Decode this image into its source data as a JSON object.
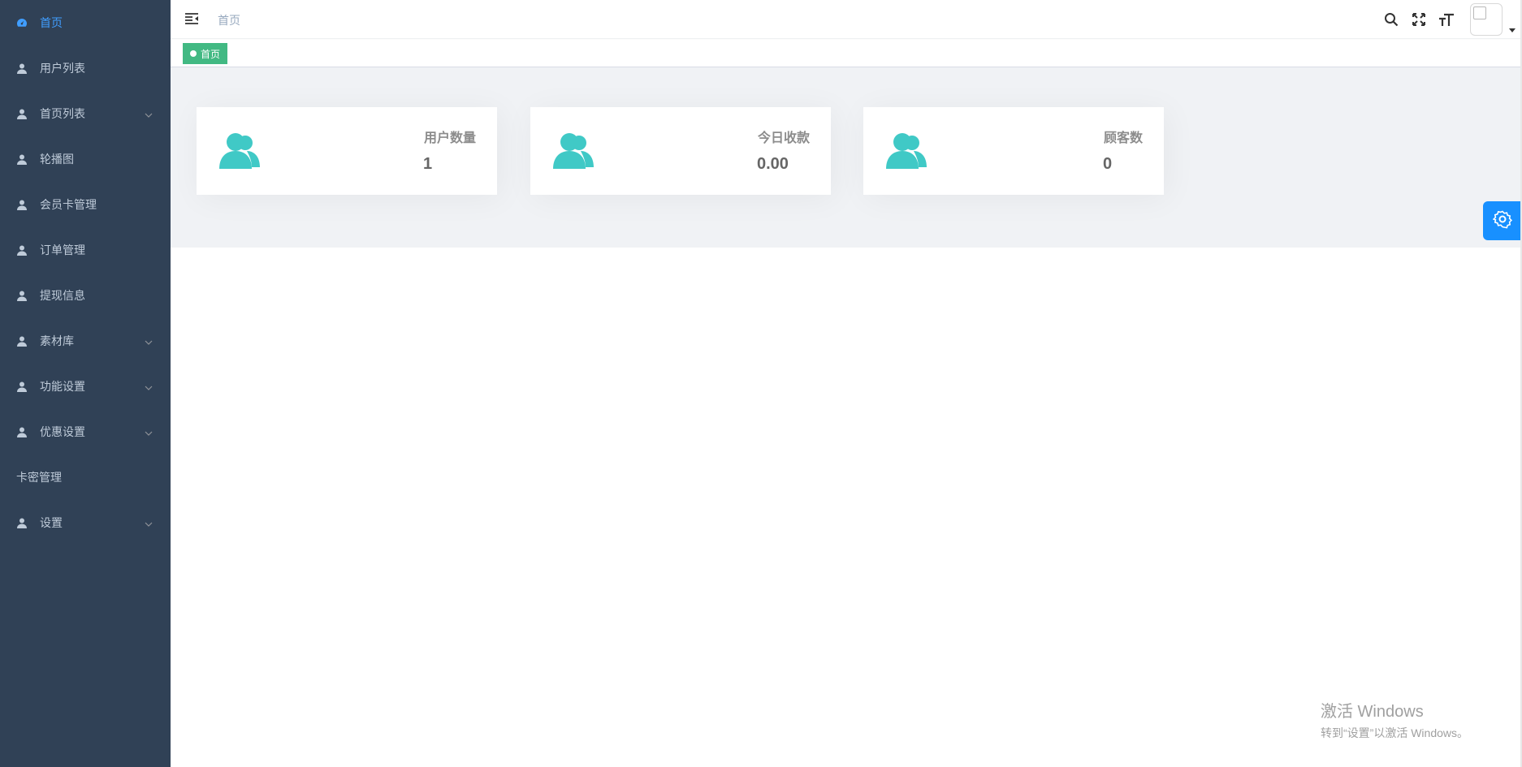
{
  "sidebar": {
    "items": [
      {
        "label": "首页",
        "icon": "dashboard-icon",
        "active": true,
        "has_children": false
      },
      {
        "label": "用户列表",
        "icon": "user-icon",
        "active": false,
        "has_children": false
      },
      {
        "label": "首页列表",
        "icon": "user-icon",
        "active": false,
        "has_children": true
      },
      {
        "label": "轮播图",
        "icon": "user-icon",
        "active": false,
        "has_children": false
      },
      {
        "label": "会员卡管理",
        "icon": "user-icon",
        "active": false,
        "has_children": false
      },
      {
        "label": "订单管理",
        "icon": "user-icon",
        "active": false,
        "has_children": false
      },
      {
        "label": "提现信息",
        "icon": "user-icon",
        "active": false,
        "has_children": false
      },
      {
        "label": "素材库",
        "icon": "user-icon",
        "active": false,
        "has_children": true
      },
      {
        "label": "功能设置",
        "icon": "user-icon",
        "active": false,
        "has_children": true
      },
      {
        "label": "优惠设置",
        "icon": "user-icon",
        "active": false,
        "has_children": true
      },
      {
        "label": "卡密管理",
        "icon": "",
        "active": false,
        "has_children": false
      },
      {
        "label": "设置",
        "icon": "user-icon",
        "active": false,
        "has_children": true
      }
    ]
  },
  "navbar": {
    "breadcrumb": "首页",
    "icons": [
      "search-icon",
      "fullscreen-icon",
      "font-size-icon"
    ]
  },
  "tags": {
    "active_tag": "首页"
  },
  "cards": [
    {
      "title": "用户数量",
      "value": "1",
      "icon": "people-icon"
    },
    {
      "title": "今日收款",
      "value": "0.00",
      "icon": "people-icon"
    },
    {
      "title": "顾客数",
      "value": "0",
      "icon": "people-icon"
    }
  ],
  "watermark": {
    "line1": "激活 Windows",
    "line2": "转到“设置”以激活 Windows。"
  },
  "colors": {
    "sidebar_bg": "#304156",
    "sidebar_text": "#bfcbd9",
    "active": "#409eff",
    "tag": "#42b983",
    "card_icon": "#40c9c6",
    "settings_btn": "#1890ff"
  }
}
